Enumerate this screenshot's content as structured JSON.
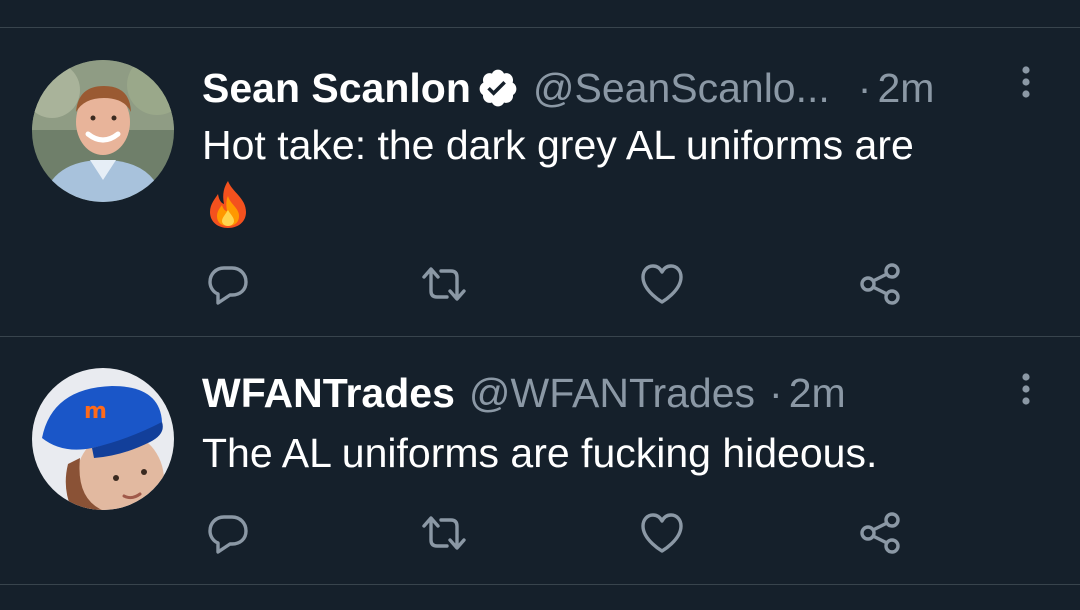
{
  "tweets": [
    {
      "name": "Sean Scanlon",
      "verified": true,
      "handle": "@SeanScanlo...",
      "separator": "·",
      "time": "2m",
      "text": "Hot take: the dark grey AL uniforms are",
      "emoji": "fire-emoji",
      "avatar": "man-in-blue-shirt-photo"
    },
    {
      "name": "WFANTrades",
      "verified": false,
      "handle": "@WFANTrades",
      "separator": "·",
      "time": "2m",
      "text": "The AL uniforms are fucking hideous.",
      "avatar": "person-in-mets-cap-photo"
    }
  ],
  "actions": [
    "reply-icon",
    "retweet-icon",
    "like-icon",
    "share-icon"
  ],
  "colors": {
    "background": "#15202b",
    "divider": "#38444d",
    "secondary_text": "#8b98a5",
    "primary_text": "#ffffff"
  }
}
